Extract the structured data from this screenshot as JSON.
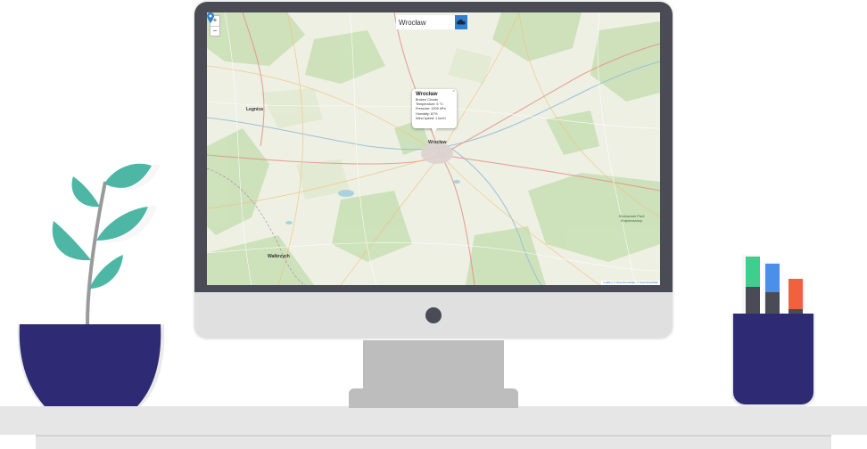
{
  "map": {
    "search": {
      "value": "Wrocław"
    },
    "zoom": {
      "in_label": "+",
      "out_label": "−"
    },
    "popup": {
      "city": "Wrocław",
      "description": "Broken Clouds",
      "temperature": "Temperature: 5 °C",
      "pressure": "Pressure: 1009 hPa",
      "humidity": "Humidity: 87%",
      "wind": "Wind speed: 1 km/h",
      "close": "×"
    },
    "labels": {
      "legnica": "Legnica",
      "wroclaw": "Wrocław",
      "walbrzych": "Wałbrzych",
      "park": "Stobrawski Park Krajobrazowy"
    },
    "attribution": "Leaflet | © OpenStreetMap, © OpenStreetMap"
  },
  "colors": {
    "screen_bezel": "#4a4b55",
    "search_button": "#2f7fd3",
    "plant_pot": "#2e2a73",
    "leaf": "#4db6a4",
    "pen_green": "#3ecf8e",
    "pen_blue": "#4a8fe8",
    "pen_red": "#f2613f"
  },
  "icons": {
    "search_button": "weather-cloud-icon",
    "marker": "map-pin-icon"
  }
}
